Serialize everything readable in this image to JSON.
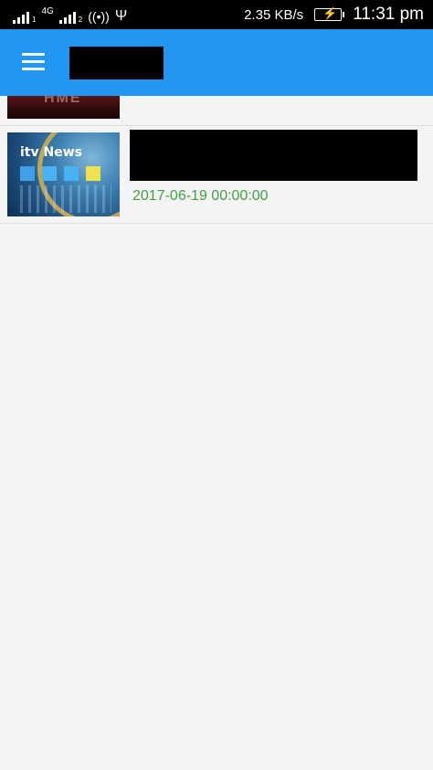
{
  "status_bar": {
    "network_label": "4G",
    "sim1_sub": "1",
    "sim2_sub": "2",
    "speed": "2.35 KB/s",
    "time": "11:31 pm"
  },
  "app_bar": {
    "background": "#2196f3",
    "menu_icon": "hamburger-menu-icon"
  },
  "list": {
    "items": [
      {
        "thumbnail": "partially-scrolled news thumbnail",
        "date": ""
      },
      {
        "thumbnail_brand": "itv News",
        "date": "2017-06-19 00:00:00"
      }
    ]
  },
  "colors": {
    "accent": "#2196f3",
    "date": "#43a047",
    "background": "#f4f4f4"
  }
}
